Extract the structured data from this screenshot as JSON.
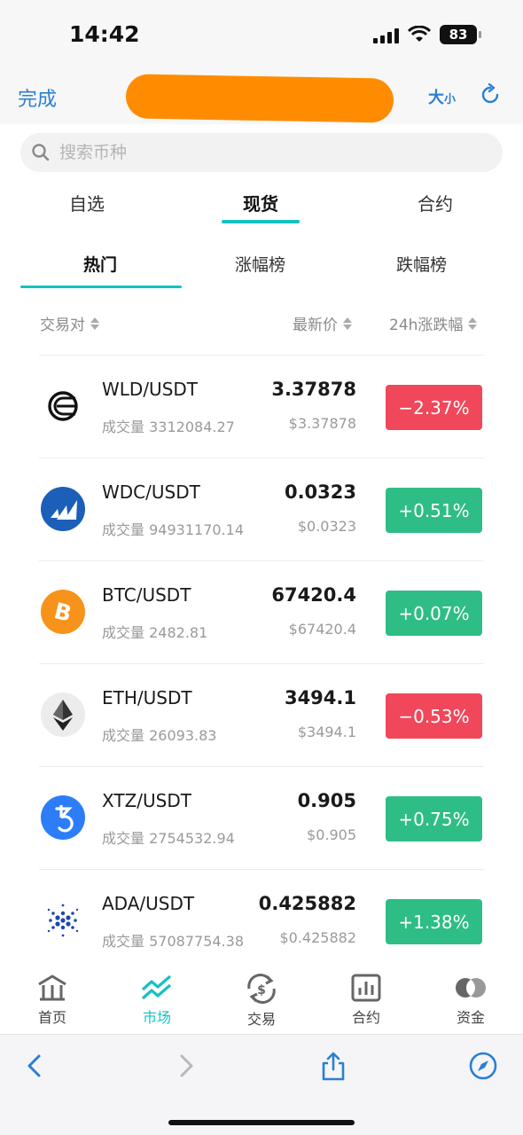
{
  "status_bar": {
    "time": "14:42",
    "battery": "83",
    "icons": [
      "signal-icon",
      "wifi-icon",
      "battery-icon"
    ]
  },
  "nav": {
    "done_label": "完成",
    "font_size_label_big": "大",
    "font_size_label_small": "小",
    "icons": [
      "refresh-icon"
    ],
    "redaction_color": "#ff8c00"
  },
  "search": {
    "placeholder": "搜索币种",
    "value": "",
    "icon": "search-icon"
  },
  "main_tabs": [
    {
      "label": "自选",
      "active": false
    },
    {
      "label": "现货",
      "active": true
    },
    {
      "label": "合约",
      "active": false
    }
  ],
  "sub_tabs": [
    {
      "label": "热门",
      "active": true
    },
    {
      "label": "涨幅榜",
      "active": false
    },
    {
      "label": "跌幅榜",
      "active": false
    }
  ],
  "columns": {
    "pair": "交易对",
    "price": "最新价",
    "change": "24h涨跌幅"
  },
  "volume_prefix": "成交量",
  "rows": [
    {
      "pair": "WLD/USDT",
      "volume": "3312084.27",
      "price": "3.37878",
      "price_usd": "$3.37878",
      "change": "−2.37%",
      "direction": "down",
      "icon": "worldcoin-icon"
    },
    {
      "pair": "WDC/USDT",
      "volume": "94931170.14",
      "price": "0.0323",
      "price_usd": "$0.0323",
      "change": "+0.51%",
      "direction": "up",
      "icon": "worldcoin-wdc-icon"
    },
    {
      "pair": "BTC/USDT",
      "volume": "2482.81",
      "price": "67420.4",
      "price_usd": "$67420.4",
      "change": "+0.07%",
      "direction": "up",
      "icon": "bitcoin-icon"
    },
    {
      "pair": "ETH/USDT",
      "volume": "26093.83",
      "price": "3494.1",
      "price_usd": "$3494.1",
      "change": "−0.53%",
      "direction": "down",
      "icon": "ethereum-icon"
    },
    {
      "pair": "XTZ/USDT",
      "volume": "2754532.94",
      "price": "0.905",
      "price_usd": "$0.905",
      "change": "+0.75%",
      "direction": "up",
      "icon": "tezos-icon"
    },
    {
      "pair": "ADA/USDT",
      "volume": "57087754.38",
      "price": "0.425882",
      "price_usd": "$0.425882",
      "change": "+1.38%",
      "direction": "up",
      "icon": "cardano-icon"
    }
  ],
  "colors": {
    "up": "#2ebd85",
    "down": "#f0475a",
    "accent": "#17c1c1",
    "link": "#2a7fd4"
  },
  "tab_bar": [
    {
      "label": "首页",
      "icon": "home-icon",
      "active": false
    },
    {
      "label": "市场",
      "icon": "market-chart-icon",
      "active": true
    },
    {
      "label": "交易",
      "icon": "exchange-icon",
      "active": false
    },
    {
      "label": "合约",
      "icon": "contract-chart-icon",
      "active": false
    },
    {
      "label": "资金",
      "icon": "funds-icon",
      "active": false
    }
  ],
  "safari_bar": {
    "icons": [
      "back-icon",
      "forward-icon",
      "share-icon",
      "compass-icon"
    ]
  }
}
